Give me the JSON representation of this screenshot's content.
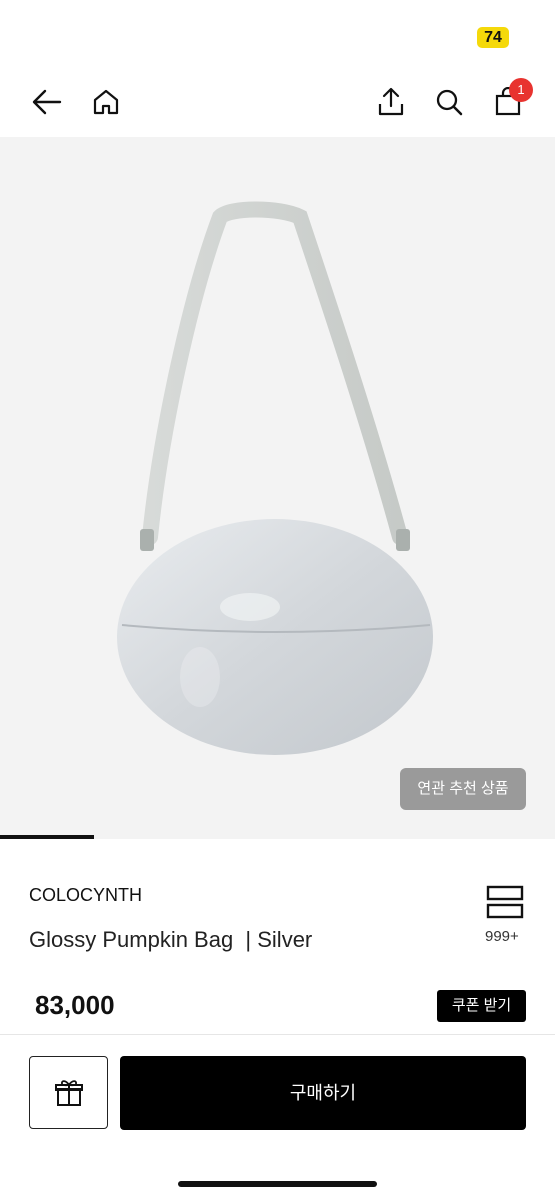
{
  "status_bar": {
    "badge": "74"
  },
  "nav": {
    "back_icon": "arrow-left-icon",
    "home_icon": "home-icon",
    "share_icon": "share-icon",
    "search_icon": "search-icon",
    "cart_icon": "shopping-bag-icon",
    "cart_count": "1"
  },
  "product": {
    "image": "silver-pumpkin-bag-photo",
    "related_button": "연관 추천 상품",
    "carousel_progress": 0.17,
    "brand": "COLOCYNTH",
    "title": "Glossy Pumpkin Bag  | Silver",
    "wish_count": "999+",
    "price": "83,000",
    "coupon_button": "쿠폰 받기"
  },
  "actions": {
    "gift_icon": "gift-icon",
    "buy_button": "구매하기"
  },
  "colors": {
    "accent": "#000000",
    "badge_yellow": "#f5d90a",
    "badge_red": "#e8332f",
    "image_bg": "#f3f3f3"
  }
}
